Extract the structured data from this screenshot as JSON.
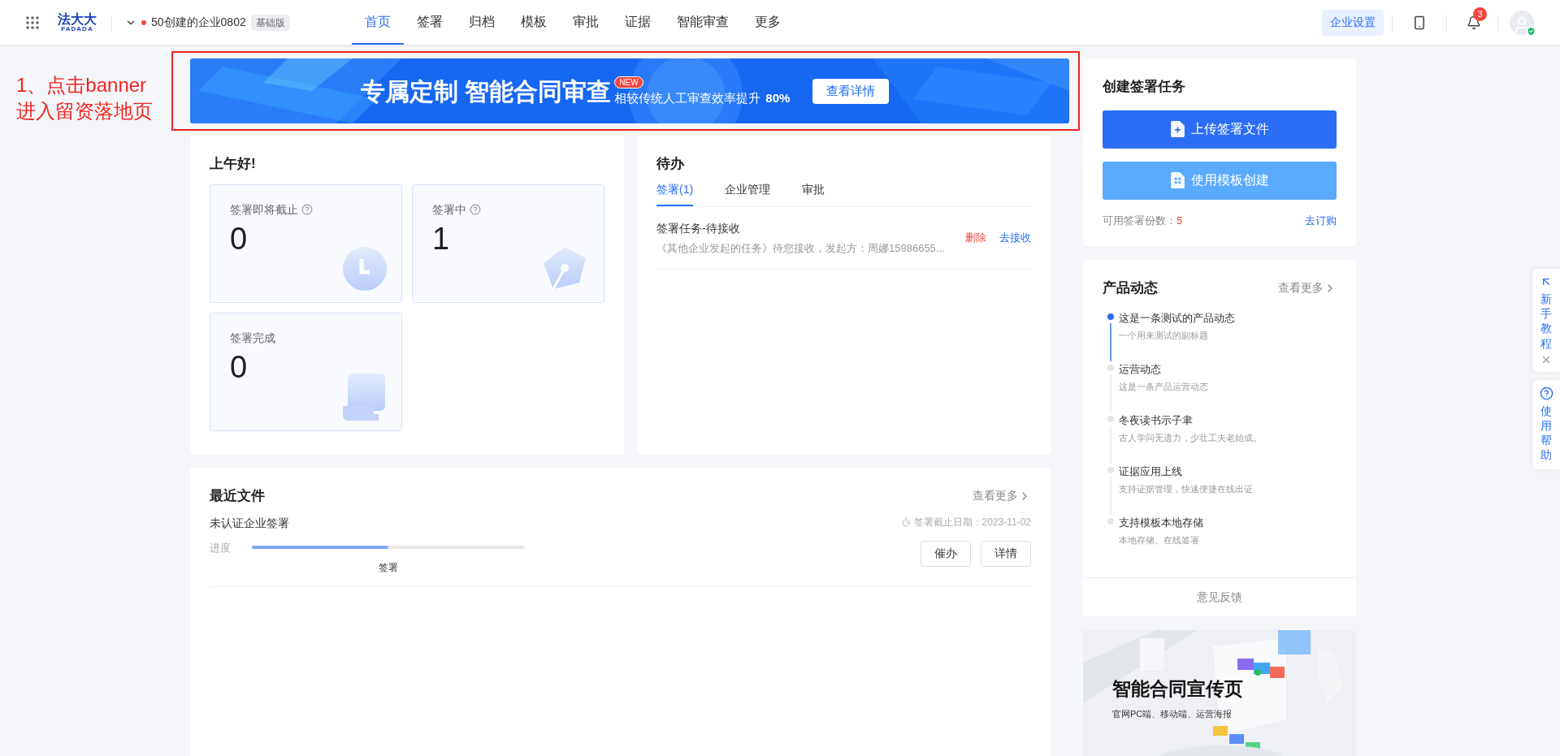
{
  "top_bar": {
    "logo": {
      "name": "法大大",
      "sub": "FADADA"
    },
    "org": {
      "name": "50创建的企业0802",
      "badge": "基础版"
    },
    "nav": [
      {
        "label": "首页",
        "selected": true
      },
      {
        "label": "签署",
        "selected": false
      },
      {
        "label": "归档",
        "selected": false
      },
      {
        "label": "模板",
        "selected": false
      },
      {
        "label": "审批",
        "selected": false
      },
      {
        "label": "证据",
        "selected": false
      },
      {
        "label": "智能审查",
        "selected": false
      },
      {
        "label": "更多",
        "selected": false
      }
    ],
    "settings_button": "企业设置",
    "notification_count": "3"
  },
  "annotation": {
    "lines": [
      "1、点击banner",
      "进入留资落地页"
    ]
  },
  "banner": {
    "title": "专属定制 智能合同审查",
    "badge": "NEW",
    "subtitle": "相较传统人工审查效率提升",
    "highlight": "80%",
    "button": "查看详情"
  },
  "greeting_card": {
    "title": "上午好!",
    "stats": [
      {
        "label": "签署即将截止",
        "value": "0",
        "help": true,
        "kind": "clock"
      },
      {
        "label": "签署中",
        "value": "1",
        "help": true,
        "kind": "pen"
      },
      {
        "label": "签署完成",
        "value": "0",
        "help": false,
        "kind": "scroll"
      }
    ]
  },
  "todo": {
    "title": "待办",
    "tabs": [
      {
        "label": "签署(1)",
        "selected": true
      },
      {
        "label": "企业管理",
        "selected": false
      },
      {
        "label": "审批",
        "selected": false
      }
    ],
    "items": [
      {
        "title": "签署任务-待接收",
        "desc": "《其他企业发起的任务》待您接收，发起方：周娜15986655...",
        "actions": [
          {
            "label": "删除",
            "kind": "danger"
          },
          {
            "label": "去接收",
            "kind": "link"
          }
        ]
      }
    ]
  },
  "recent_files": {
    "title": "最近文件",
    "more": "查看更多",
    "files": [
      {
        "name": "未认证企业签署",
        "deadline": "签署截止日期：2023-11-02",
        "progress_label": "进度",
        "level": 0.5,
        "stage": "签署",
        "buttons": [
          "催办",
          "详情"
        ]
      }
    ]
  },
  "create_task": {
    "title": "创建签署任务",
    "buttons": [
      {
        "label": "上传签署文件",
        "kind": "upload"
      },
      {
        "label": "使用模板创建",
        "kind": "template"
      }
    ],
    "quota_label": "可用签署份数：",
    "quota": "5",
    "buy": "去订购"
  },
  "product_news": {
    "title": "产品动态",
    "more": "查看更多",
    "items": [
      {
        "title": "这是一条测试的产品动态",
        "subtitle": "一个用来测试的副标题",
        "selected": true
      },
      {
        "title": "运营动态",
        "subtitle": "这是一条产品运营动态",
        "selected": false
      },
      {
        "title": "冬夜读书示子聿",
        "subtitle": "古人学问无遗力，少壮工夫老始成。",
        "selected": false
      },
      {
        "title": "证据应用上线",
        "subtitle": "支持证据管理，快速便捷在线出证",
        "selected": false
      },
      {
        "title": "支持模板本地存储",
        "subtitle": "本地存储、在线签署",
        "selected": false
      }
    ],
    "feedback": "意见反馈"
  },
  "promo": {
    "title": "智能合同宣传页",
    "subtitle": "官网PC端、移动端、运营海报"
  },
  "side_tools": [
    {
      "label": "新手教程",
      "kind": "tutorial",
      "closable": true
    },
    {
      "label": "使用帮助",
      "kind": "help",
      "closable": false
    }
  ]
}
